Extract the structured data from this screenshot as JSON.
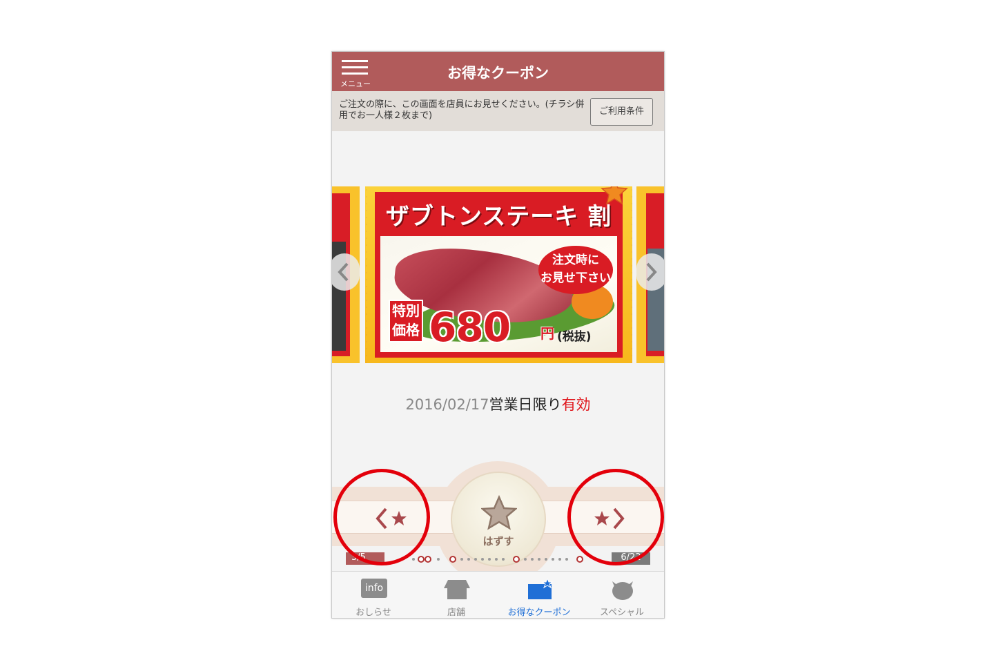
{
  "header": {
    "menu_label": "メニュー",
    "title": "お得なクーポン"
  },
  "notice": {
    "text": "ご注文の際に、この画面を店員にお見せください。(チラシ併用でお一人様２枚まで)",
    "terms_button": "ご利用条件"
  },
  "coupon": {
    "title": "ザブトンステーキ 割引券",
    "badge_line1": "注文時に",
    "badge_line2": "お見せ下さい",
    "price_label_line1": "特別",
    "price_label_line2": "価格",
    "price": "680",
    "price_unit": "円",
    "tax_note": "(税抜)"
  },
  "validity": {
    "date": "2016/02/17",
    "text": "営業日限り",
    "status": "有効"
  },
  "actions": {
    "remove_label": "はずす"
  },
  "pager": {
    "left": "3/5",
    "right": "6/22"
  },
  "tabs": [
    {
      "label": "おしらせ",
      "icon": "info-icon",
      "icon_text": "info"
    },
    {
      "label": "店舗",
      "icon": "store-icon"
    },
    {
      "label": "お得なクーポン",
      "icon": "coupon-icon"
    },
    {
      "label": "スペシャル",
      "icon": "special-icon"
    }
  ],
  "colors": {
    "header": "#b15b5b",
    "accent_red": "#e3000b",
    "active_tab": "#1f6fd6",
    "valid": "#e0161c"
  }
}
